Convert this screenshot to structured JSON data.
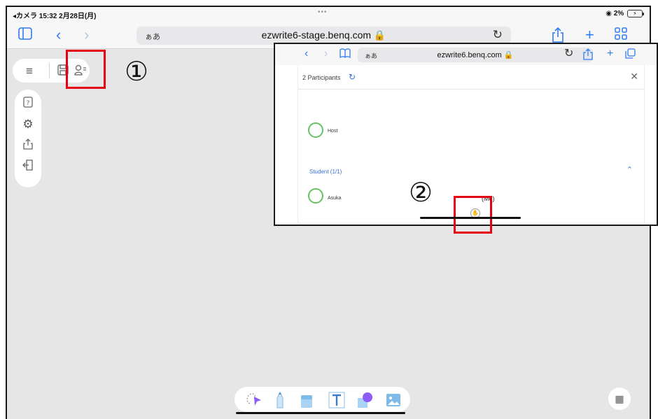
{
  "statusbar": {
    "left_text": "◂カメラ  15:32  2月28日(月)",
    "center_dots": "•••",
    "wifi_battery": "2%"
  },
  "browser": {
    "aa_label": "ぁあ",
    "url": "ezwrite6-stage.benq.com 🔒"
  },
  "annotations": {
    "step1": "①",
    "step2": "②"
  },
  "inset": {
    "aa_label": "ぁあ",
    "url": "ezwrite6.benq.com 🔒",
    "participants_title": "2 Participants",
    "host_name": "Host",
    "section_label": "Student (1/1)",
    "student_name": "Asuka",
    "me_label": "(Me)"
  },
  "icons": {
    "accent_color": "#2f7cf6",
    "participant_ring_color": "#62c462",
    "highlight_color": "#e60012"
  }
}
